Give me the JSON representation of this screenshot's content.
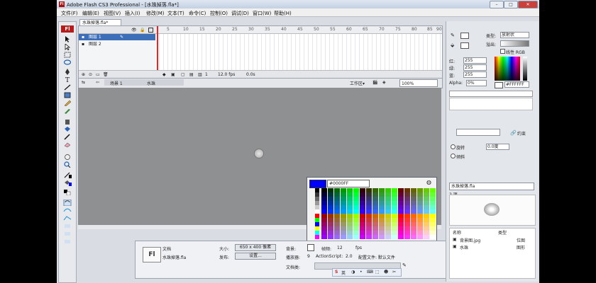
{
  "window": {
    "title": "Adobe Flash CS3 Professional - [水珠掉落.fla*]",
    "app_badge": "Fl"
  },
  "menu": [
    "文件(F)",
    "编辑(E)",
    "视图(V)",
    "插入(I)",
    "修改(M)",
    "文本(T)",
    "命令(C)",
    "控制(O)",
    "调试(D)",
    "窗口(W)",
    "帮助(H)"
  ],
  "tools": {
    "badge": "Fl"
  },
  "document": {
    "tab": "水珠掉落.fla*"
  },
  "timeline": {
    "layers": [
      {
        "name": "图层 1",
        "selected": true
      },
      {
        "name": "图层 2",
        "selected": false
      }
    ],
    "ruler": [
      "5",
      "10",
      "15",
      "20",
      "25",
      "30",
      "35",
      "40",
      "45",
      "50",
      "55",
      "60",
      "65",
      "70",
      "75",
      "80",
      "85",
      "90"
    ],
    "footer": {
      "frame": "1",
      "fps": "12.0 fps",
      "time": "0.0s"
    }
  },
  "editbar": {
    "scene": "场景 1",
    "symbol": "水珠",
    "workspace": "工作区▾",
    "zoom": "100%"
  },
  "palette": {
    "hex": "#0000FF",
    "selected_color": "#0000ff"
  },
  "properties": {
    "badge": "Fl",
    "doc_label": "文档",
    "doc_name": "水珠掉落.fla",
    "size_label": "大小:",
    "size_value": "650 x 400 像素",
    "bg_label": "背景:",
    "fps_label": "帧频:",
    "fps_value": "12",
    "fps_unit": "fps",
    "publish_label": "发布:",
    "settings_button": "设置...",
    "player_label": "播放器:",
    "player_value": "9",
    "as_label": "ActionScript:",
    "as_value": "2.0",
    "profile": "配置文件: 默认文件",
    "doc_class_label": "文档类:"
  },
  "color_panel": {
    "type_label": "类型:",
    "type_value": "放射状",
    "overflow_label": "溢出:",
    "linear_rgb": "线性 RGB",
    "red_label": "红:",
    "red_value": "255",
    "green_label": "绿:",
    "green_value": "255",
    "blue_label": "蓝:",
    "blue_value": "255",
    "alpha_label": "Alpha:",
    "alpha_value": "0%",
    "hex": "#FFFFFF"
  },
  "transform": {
    "constrain": "约束",
    "rotate": "旋转",
    "skew": "倾斜",
    "rotate_value": "0.0度"
  },
  "library": {
    "file": "水珠掉落.fla",
    "count": "2 项",
    "col_name": "名称",
    "col_type": "类型",
    "items": [
      {
        "name": "背景图.jpg",
        "type": "位图"
      },
      {
        "name": "水珠",
        "type": "图形"
      }
    ]
  },
  "ime": {
    "lang": "英"
  }
}
